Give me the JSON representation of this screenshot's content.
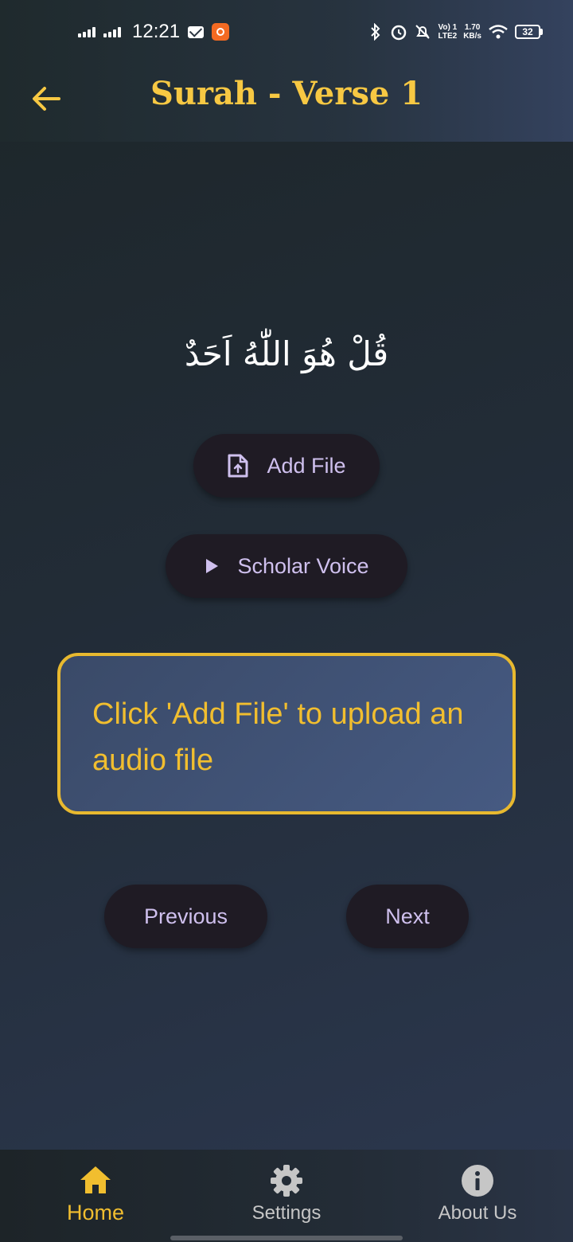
{
  "status_bar": {
    "time": "12:21",
    "network_type": "LTE2",
    "volte": "Vo) 1",
    "speed_value": "1.70",
    "speed_unit": "KB/s",
    "battery": "32"
  },
  "header": {
    "title": "Surah - Verse 1",
    "back_icon": "arrow-left-icon"
  },
  "main": {
    "verse_text": "قُلْ هُوَ اللّٰهُ اَحَدٌ",
    "add_file_label": "Add File",
    "add_file_icon": "file-upload-icon",
    "scholar_voice_label": "Scholar Voice",
    "scholar_voice_icon": "play-icon",
    "info_message": "Click 'Add File' to upload an audio file",
    "previous_label": "Previous",
    "next_label": "Next"
  },
  "bottom_nav": {
    "items": [
      {
        "label": "Home",
        "icon": "home-icon",
        "active": true
      },
      {
        "label": "Settings",
        "icon": "gear-icon",
        "active": false
      },
      {
        "label": "About Us",
        "icon": "info-icon",
        "active": false
      }
    ]
  },
  "colors": {
    "accent": "#f7c843",
    "button_text": "#cfc0ee",
    "button_bg": "#1f1b24",
    "info_border": "#e8b92f"
  }
}
